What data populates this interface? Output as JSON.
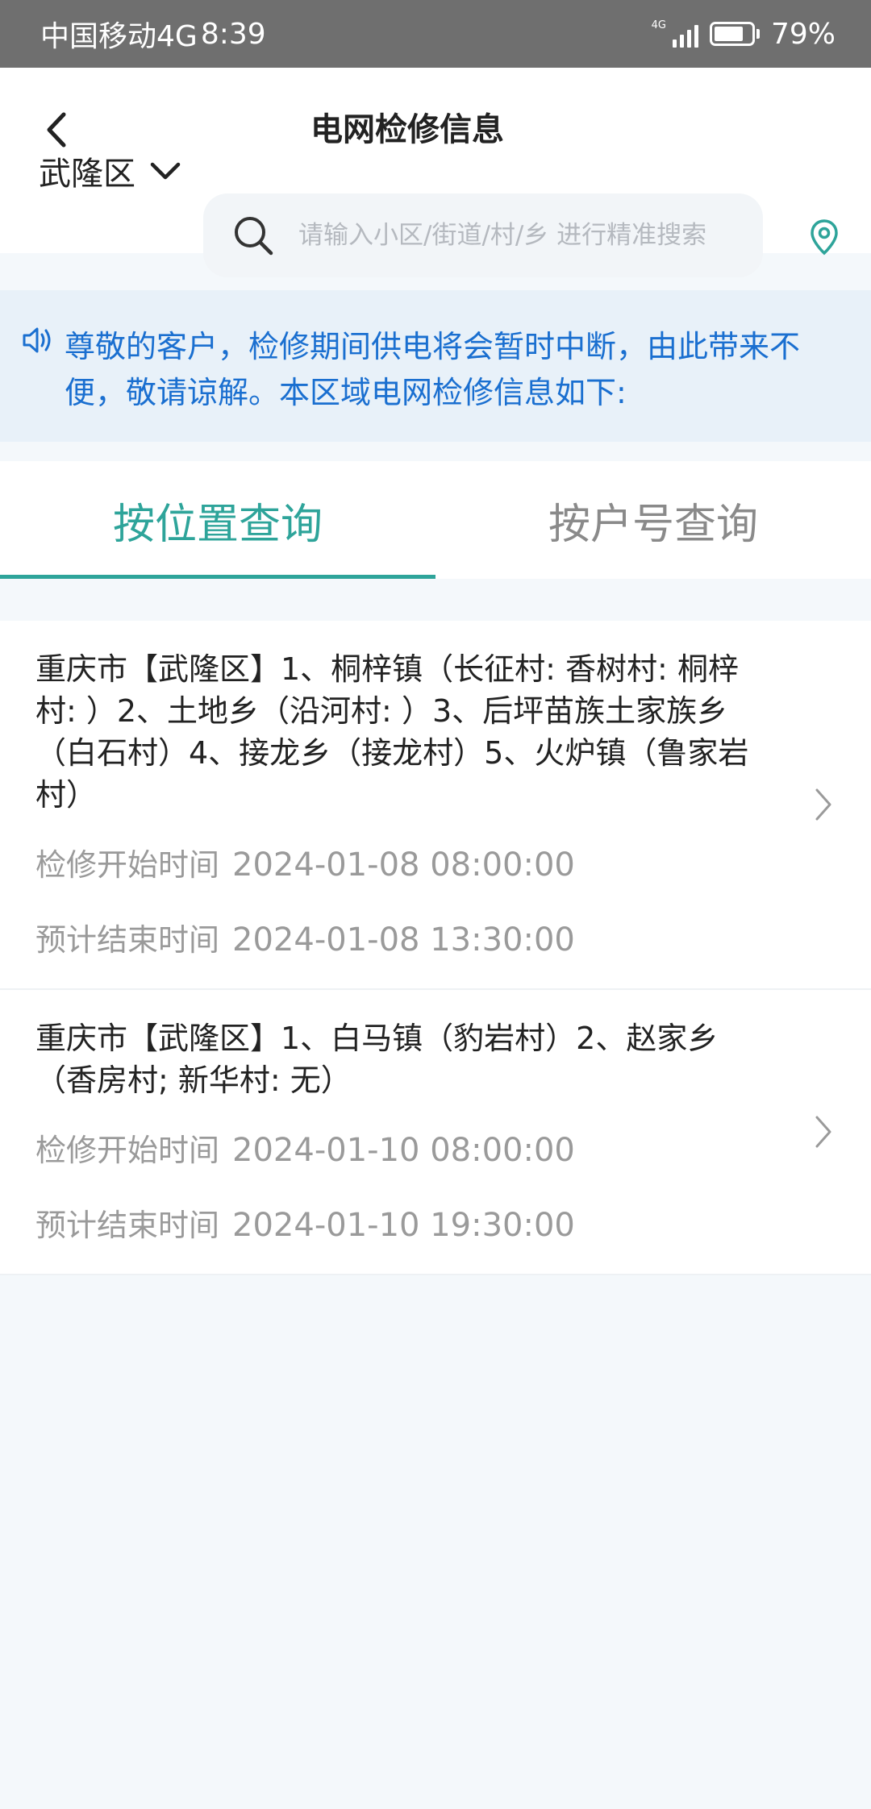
{
  "status": {
    "carrier": "中国移动4G",
    "time": "8:39",
    "net_tag": "4G",
    "battery": "79%",
    "battery_level": 0.79
  },
  "header": {
    "title": "电网检修信息",
    "district": "武隆区",
    "search_placeholder": "请输入小区/街道/村/乡 进行精准搜索"
  },
  "notice": {
    "text": "尊敬的客户，检修期间供电将会暂时中断，由此带来不便，敬请谅解。本区域电网检修信息如下:"
  },
  "tabs": [
    {
      "label": "按位置查询",
      "active": true
    },
    {
      "label": "按户号查询",
      "active": false
    }
  ],
  "records": [
    {
      "title": "重庆市【武隆区】1、桐梓镇（长征村: 香树村: 桐梓村: ）2、土地乡（沿河村: ）3、后坪苗族土家族乡（白石村）4、接龙乡（接龙村）5、火炉镇（鲁家岩村）",
      "start_label": "检修开始时间",
      "start": "2024-01-08 08:00:00",
      "end_label": "预计结束时间",
      "end": "2024-01-08 13:30:00"
    },
    {
      "title": "重庆市【武隆区】1、白马镇（豹岩村）2、赵家乡（香房村; 新华村: 无）",
      "start_label": "检修开始时间",
      "start": "2024-01-10 08:00:00",
      "end_label": "预计结束时间",
      "end": "2024-01-10 19:30:00"
    }
  ],
  "colors": {
    "accent": "#2ea49a",
    "notice_text": "#1a6fd0",
    "notice_bg": "#e8f1f9"
  }
}
